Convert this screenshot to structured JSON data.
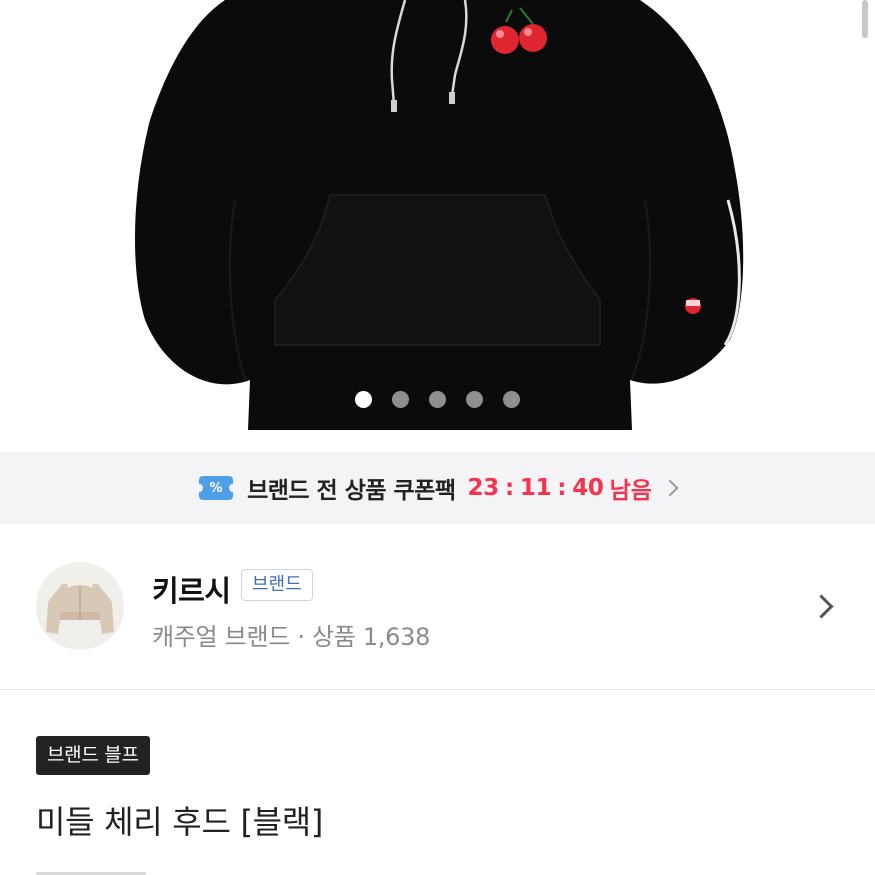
{
  "carousel": {
    "total_slides": 5,
    "active_slide": 1
  },
  "coupon": {
    "icon": "coupon-ticket-icon",
    "icon_glyph": "%",
    "text": "브랜드 전 상품 쿠폰팩",
    "timer": {
      "hours": "23",
      "minutes": "11",
      "seconds": "40",
      "separator": ":"
    },
    "remaining_label": "남음",
    "accent_color": "#f5334f",
    "icon_color": "#4f9fe8"
  },
  "brand": {
    "name": "키르시",
    "badge": "브랜드",
    "meta": "캐주얼 브랜드 · 상품 1,638",
    "avatar_icon": "jacket-thumbnail",
    "badge_color": "#3f6fb8"
  },
  "product": {
    "tag": "브랜드 블프",
    "title": "미들 체리 후드 [블랙]"
  },
  "colors": {
    "hoodie": "#0b0b0b",
    "cherry": "#e0262f",
    "banner_bg": "#f4f4f6"
  }
}
